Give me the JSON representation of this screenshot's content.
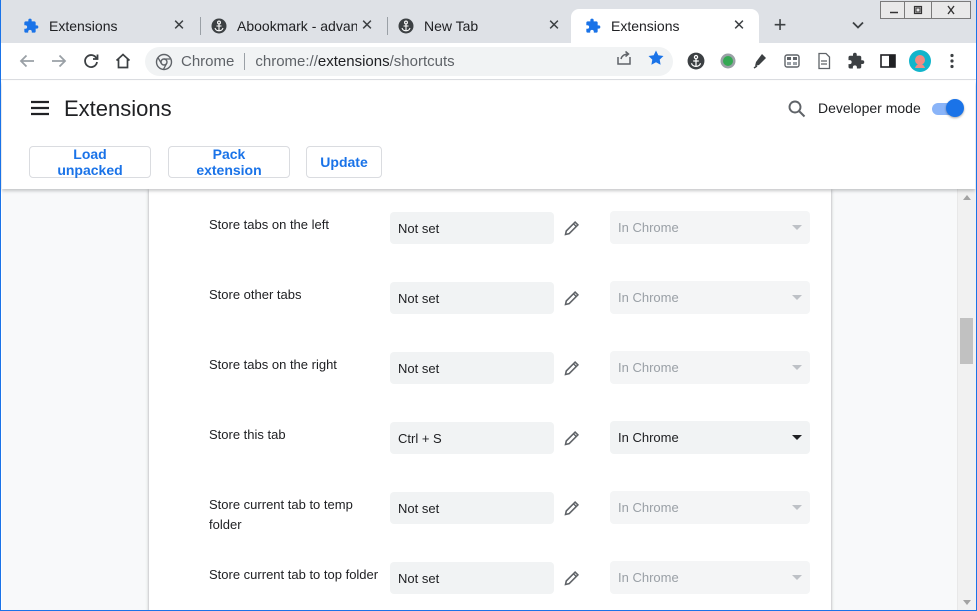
{
  "colors": {
    "accent": "#1a73e8",
    "tabstrip": "#dee1e6",
    "content_bg": "#f8f9fa"
  },
  "tabs": [
    {
      "title": "Extensions",
      "icon": "puzzle-icon",
      "active": false
    },
    {
      "title": "Abookmark - advanc",
      "icon": "anchor-icon",
      "active": false
    },
    {
      "title": "New Tab",
      "icon": "anchor-icon",
      "active": false
    },
    {
      "title": "Extensions",
      "icon": "puzzle-icon",
      "active": true
    }
  ],
  "omnibox": {
    "site_name": "Chrome",
    "url_scheme": "chrome://",
    "url_host": "extensions",
    "url_path": "/shortcuts"
  },
  "header": {
    "title": "Extensions",
    "developer_mode_label": "Developer mode",
    "developer_mode_on": true,
    "buttons": {
      "load_unpacked": "Load unpacked",
      "pack_extension": "Pack extension",
      "update": "Update"
    }
  },
  "shortcuts": [
    {
      "command": "Store tabs on the left",
      "shortcut": "Not set",
      "scope": "In Chrome",
      "scope_enabled": false
    },
    {
      "command": "Store other tabs",
      "shortcut": "Not set",
      "scope": "In Chrome",
      "scope_enabled": false
    },
    {
      "command": "Store tabs on the right",
      "shortcut": "Not set",
      "scope": "In Chrome",
      "scope_enabled": false
    },
    {
      "command": "Store this tab",
      "shortcut": "Ctrl + S",
      "scope": "In Chrome",
      "scope_enabled": true
    },
    {
      "command": "Store current tab to temp folder",
      "shortcut": "Not set",
      "scope": "In Chrome",
      "scope_enabled": false
    },
    {
      "command": "Store current tab to top folder",
      "shortcut": "Not set",
      "scope": "In Chrome",
      "scope_enabled": false
    }
  ]
}
